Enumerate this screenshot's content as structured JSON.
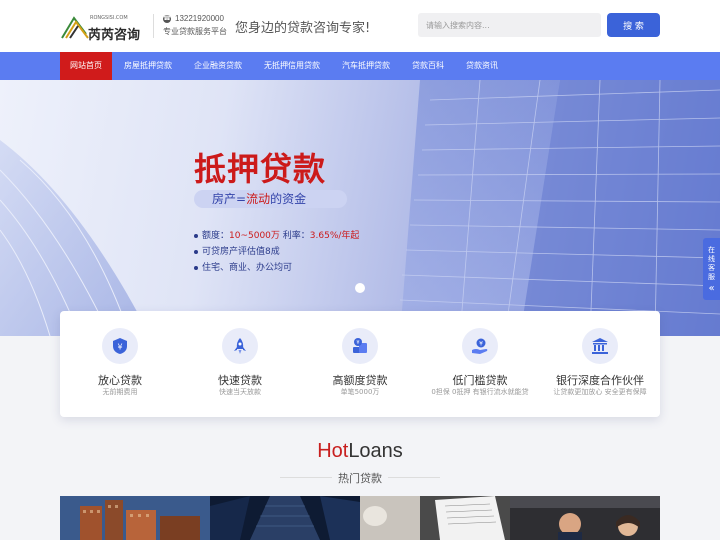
{
  "header": {
    "logo_small": "RONGSISI.COM",
    "logo_name": "芮芮咨询",
    "phone": "13221920000",
    "subtitle": "专业贷款服务平台",
    "slogan": "您身边的贷款咨询专家!",
    "search_placeholder": "请输入搜索内容...",
    "search_button": "搜 索"
  },
  "nav": {
    "items": [
      "网站首页",
      "房屋抵押贷款",
      "企业融资贷款",
      "无抵押信用贷款",
      "汽车抵押贷款",
      "贷款百科",
      "贷款资讯"
    ],
    "active_index": 0
  },
  "banner": {
    "title": "抵押贷款",
    "pill_prefix": "房产=",
    "pill_highlight": "流动",
    "pill_suffix": "的资金",
    "bullet1_label": "额度：",
    "bullet1_value1": "10~5000万",
    "bullet1_mid": "  利率：",
    "bullet1_value2": "3.65%/年起",
    "bullet2": "可贷房产评估值8成",
    "bullet3": "住宅、商业、办公均可"
  },
  "side_float": {
    "text": "在线客服",
    "arrow": "«"
  },
  "features": [
    {
      "title": "放心贷款",
      "desc": "无前期费用",
      "icon": "shield-yen-icon"
    },
    {
      "title": "快速贷款",
      "desc": "快速当天放款",
      "icon": "rocket-icon"
    },
    {
      "title": "高额度贷款",
      "desc": "单笔5000万",
      "icon": "coins-icon"
    },
    {
      "title": "低门槛贷款",
      "desc": "0担保 0抵押 有银行流水就能贷",
      "icon": "hand-money-icon"
    },
    {
      "title": "银行深度合作伙伴",
      "desc": "让贷款更加放心 安全更有保障",
      "icon": "bank-icon"
    }
  ],
  "hot": {
    "title_hot": "Hot",
    "title_rest": "Loans",
    "subtitle": "热门贷款"
  },
  "colors": {
    "primary": "#3b63d9",
    "nav": "#5b7cf1",
    "active": "#d01b1b",
    "accent_red": "#c81f1f"
  }
}
